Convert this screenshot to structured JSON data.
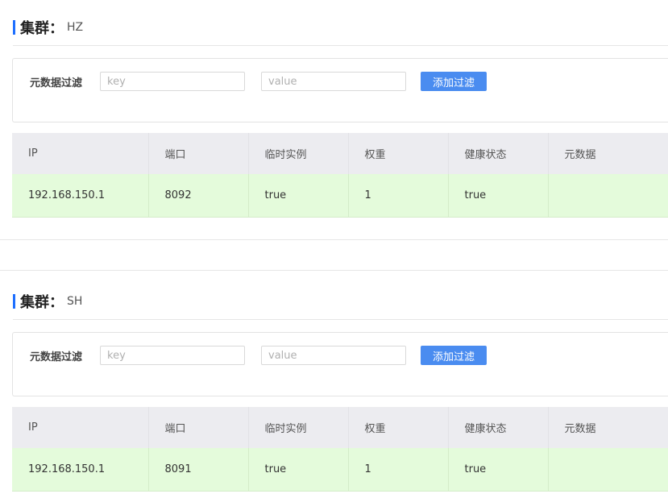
{
  "clusters": [
    {
      "title_label": "集群",
      "title_colon": "：",
      "name": "HZ",
      "filter": {
        "label": "元数据过滤",
        "key_placeholder": "key",
        "value_placeholder": "value",
        "button": "添加过滤"
      },
      "columns": [
        "IP",
        "端口",
        "临时实例",
        "权重",
        "健康状态",
        "元数据"
      ],
      "rows": [
        {
          "ip": "192.168.150.1",
          "port": "8092",
          "ephemeral": "true",
          "weight": "1",
          "healthy": "true",
          "metadata": ""
        }
      ]
    },
    {
      "title_label": "集群",
      "title_colon": "：",
      "name": "SH",
      "filter": {
        "label": "元数据过滤",
        "key_placeholder": "key",
        "value_placeholder": "value",
        "button": "添加过滤"
      },
      "columns": [
        "IP",
        "端口",
        "临时实例",
        "权重",
        "健康状态",
        "元数据"
      ],
      "rows": [
        {
          "ip": "192.168.150.1",
          "port": "8091",
          "ephemeral": "true",
          "weight": "1",
          "healthy": "true",
          "metadata": ""
        }
      ]
    }
  ],
  "colors": {
    "accent": "#1e6fff",
    "button": "#4a8cf0",
    "table_header": "#ececf0",
    "row_healthy": "#e4fbdb"
  }
}
